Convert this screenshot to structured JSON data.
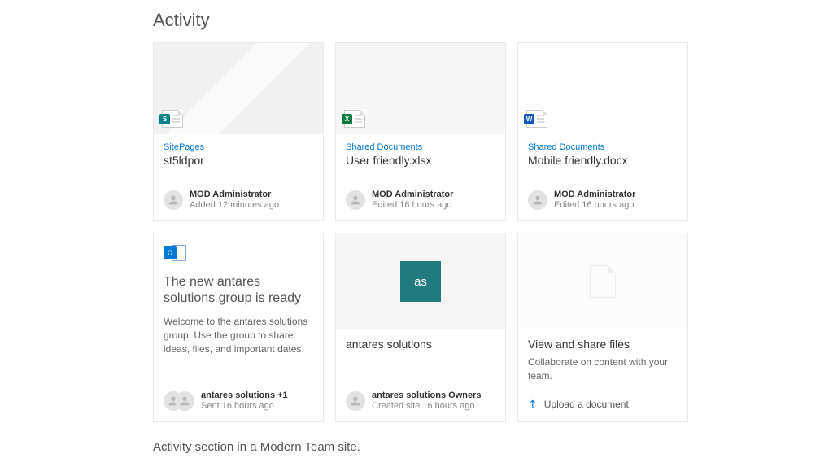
{
  "section_title": "Activity",
  "caption": "Activity section in a Modern Team site.",
  "cards": [
    {
      "location": "SitePages",
      "title": "st5ldpor",
      "author": "MOD Administrator",
      "meta": "Added 12 minutes ago",
      "icon_letter": "S",
      "icon_color": "#038387"
    },
    {
      "location": "Shared Documents",
      "title": "User friendly.xlsx",
      "author": "MOD Administrator",
      "meta": "Edited 16 hours ago",
      "icon_letter": "X",
      "icon_color": "#107c41"
    },
    {
      "location": "Shared Documents",
      "title": "Mobile friendly.docx",
      "author": "MOD Administrator",
      "meta": "Edited 16 hours ago",
      "icon_letter": "W",
      "icon_color": "#185abd"
    }
  ],
  "announce": {
    "title": "The new antares solutions group is ready",
    "desc": "Welcome to the antares solutions group. Use the group to share ideas, files, and important dates.",
    "author": "antares solutions +1",
    "meta": "Sent 16 hours ago"
  },
  "site_card": {
    "tile_label": "as",
    "title": "antares solutions",
    "author": "antares solutions Owners",
    "meta": "Created site 16 hours ago"
  },
  "share_card": {
    "title": "View and share files",
    "desc": "Collaborate on content with your team.",
    "action": "Upload a document"
  }
}
